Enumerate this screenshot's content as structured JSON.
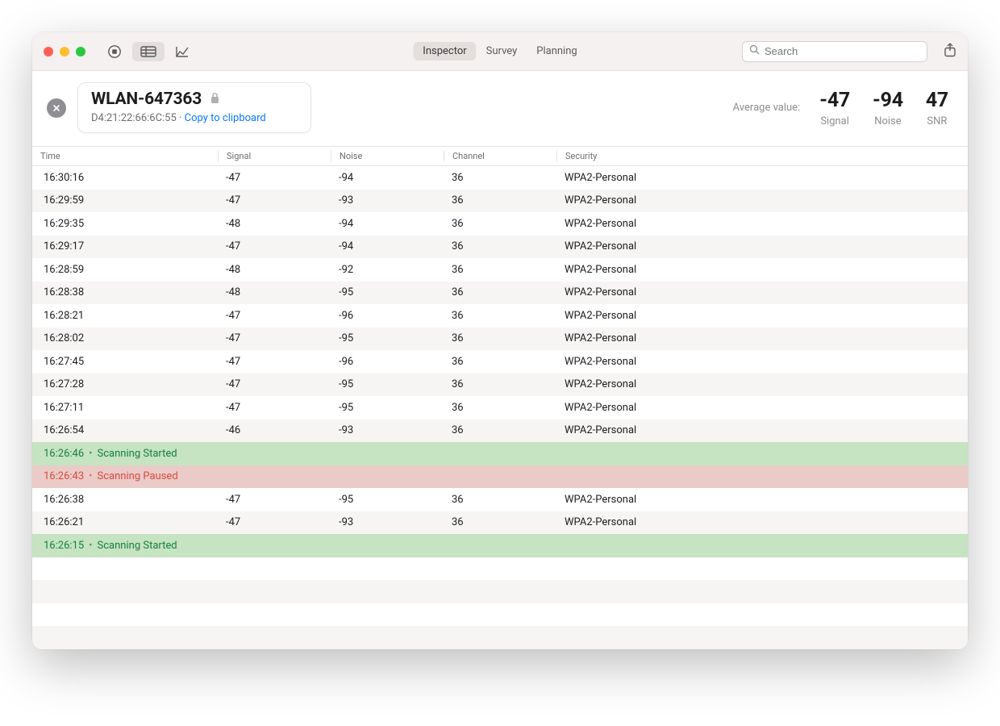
{
  "toolbar": {
    "tabs": [
      "Inspector",
      "Survey",
      "Planning"
    ],
    "active_tab": 0,
    "search_placeholder": "Search"
  },
  "network": {
    "name": "WLAN-647363",
    "bssid": "D4:21:22:66:6C:55",
    "copy_label": "Copy to clipboard"
  },
  "stats": {
    "avg_label": "Average value:",
    "signal": {
      "value": "-47",
      "label": "Signal"
    },
    "noise": {
      "value": "-94",
      "label": "Noise"
    },
    "snr": {
      "value": "47",
      "label": "SNR"
    }
  },
  "columns": {
    "time": "Time",
    "signal": "Signal",
    "noise": "Noise",
    "channel": "Channel",
    "security": "Security"
  },
  "rows": [
    {
      "type": "data",
      "time": "16:30:16",
      "signal": "-47",
      "noise": "-94",
      "channel": "36",
      "security": "WPA2-Personal"
    },
    {
      "type": "data",
      "time": "16:29:59",
      "signal": "-47",
      "noise": "-93",
      "channel": "36",
      "security": "WPA2-Personal"
    },
    {
      "type": "data",
      "time": "16:29:35",
      "signal": "-48",
      "noise": "-94",
      "channel": "36",
      "security": "WPA2-Personal"
    },
    {
      "type": "data",
      "time": "16:29:17",
      "signal": "-47",
      "noise": "-94",
      "channel": "36",
      "security": "WPA2-Personal"
    },
    {
      "type": "data",
      "time": "16:28:59",
      "signal": "-48",
      "noise": "-92",
      "channel": "36",
      "security": "WPA2-Personal"
    },
    {
      "type": "data",
      "time": "16:28:38",
      "signal": "-48",
      "noise": "-95",
      "channel": "36",
      "security": "WPA2-Personal"
    },
    {
      "type": "data",
      "time": "16:28:21",
      "signal": "-47",
      "noise": "-96",
      "channel": "36",
      "security": "WPA2-Personal"
    },
    {
      "type": "data",
      "time": "16:28:02",
      "signal": "-47",
      "noise": "-95",
      "channel": "36",
      "security": "WPA2-Personal"
    },
    {
      "type": "data",
      "time": "16:27:45",
      "signal": "-47",
      "noise": "-96",
      "channel": "36",
      "security": "WPA2-Personal"
    },
    {
      "type": "data",
      "time": "16:27:28",
      "signal": "-47",
      "noise": "-95",
      "channel": "36",
      "security": "WPA2-Personal"
    },
    {
      "type": "data",
      "time": "16:27:11",
      "signal": "-47",
      "noise": "-95",
      "channel": "36",
      "security": "WPA2-Personal"
    },
    {
      "type": "data",
      "time": "16:26:54",
      "signal": "-46",
      "noise": "-93",
      "channel": "36",
      "security": "WPA2-Personal"
    },
    {
      "type": "event",
      "time": "16:26:46",
      "status": "started",
      "message": "Scanning Started"
    },
    {
      "type": "event",
      "time": "16:26:43",
      "status": "paused",
      "message": "Scanning Paused"
    },
    {
      "type": "data",
      "time": "16:26:38",
      "signal": "-47",
      "noise": "-95",
      "channel": "36",
      "security": "WPA2-Personal"
    },
    {
      "type": "data",
      "time": "16:26:21",
      "signal": "-47",
      "noise": "-93",
      "channel": "36",
      "security": "WPA2-Personal"
    },
    {
      "type": "event",
      "time": "16:26:15",
      "status": "started",
      "message": "Scanning Started"
    }
  ]
}
